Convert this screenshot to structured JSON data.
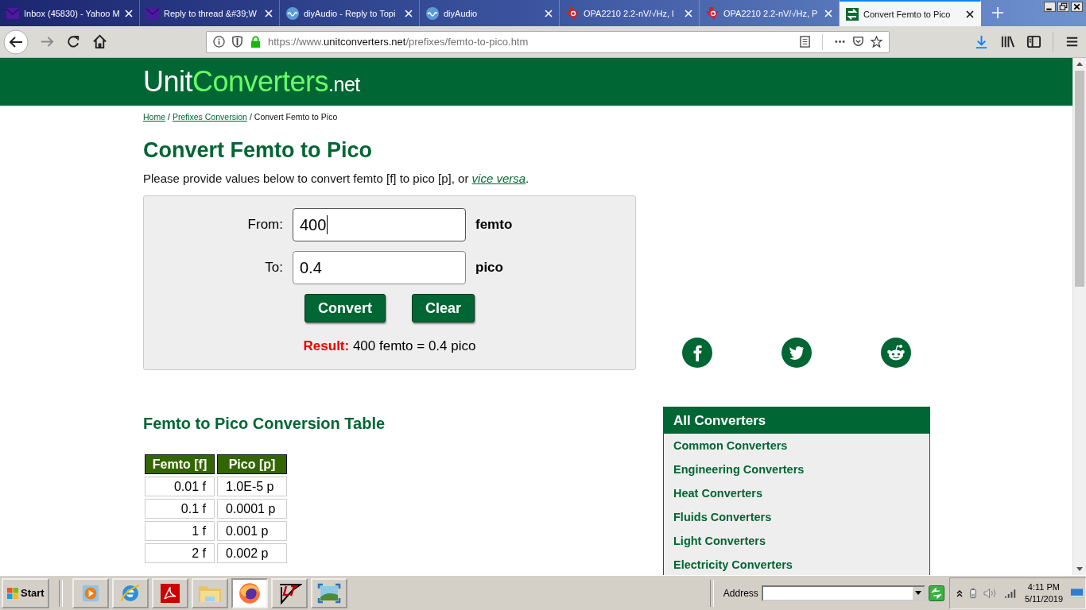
{
  "browser": {
    "tabs": [
      {
        "title": "Inbox (45830) - Yahoo M",
        "kind": "mail",
        "selected": false
      },
      {
        "title": "Reply to thread &#39;W",
        "kind": "mail",
        "selected": false
      },
      {
        "title": "diyAudio - Reply to Topi",
        "kind": "wave",
        "selected": false
      },
      {
        "title": "diyAudio",
        "kind": "wave",
        "selected": false
      },
      {
        "title": "OPA2210 2.2-nV/√Hz, l",
        "kind": "ti",
        "selected": false
      },
      {
        "title": "OPA2210 2.2-nV/√Hz, P",
        "kind": "ti",
        "selected": false
      },
      {
        "title": "Convert Femto to Pico",
        "kind": "uc",
        "selected": true
      }
    ],
    "url": {
      "scheme": "https://www.",
      "host": "unitconverters.net",
      "path": "/prefixes/femto-to-pico.htm"
    }
  },
  "site": {
    "logo": {
      "first": "Unit",
      "second": "Converters",
      "suffix": ".net"
    },
    "breadcrumb": [
      {
        "label": "Home",
        "kind": "link"
      },
      {
        "label": "Prefixes Conversion",
        "kind": "link"
      },
      {
        "label": "Convert Femto to Pico",
        "kind": "current"
      }
    ],
    "separator": "/",
    "heading": "Convert Femto to Pico",
    "intro": {
      "text": "Please provide values below to convert femto [f] to pico [p], or",
      "link": "vice versa",
      "end": "."
    },
    "converter": {
      "fields": [
        {
          "label": "From:",
          "value": "400",
          "unit": "femto",
          "focused": true
        },
        {
          "label": "To:",
          "value": "0.4",
          "unit": "pico",
          "focused": false
        }
      ],
      "buttons": [
        "Convert",
        "Clear"
      ],
      "result": {
        "label": "Result:",
        "text": "400 femto = 0.4 pico"
      }
    },
    "social": [
      {
        "kind": "facebook"
      },
      {
        "kind": "twitter"
      },
      {
        "kind": "reddit"
      }
    ],
    "table": {
      "title": "Femto to Pico Conversion Table",
      "columns": [
        "Femto [f]",
        "Pico [p]"
      ],
      "rows": [
        [
          "0.01 f",
          "1.0E-5 p"
        ],
        [
          "0.1 f",
          "0.0001 p"
        ],
        [
          "1 f",
          "0.001 p"
        ],
        [
          "2 f",
          "0.002 p"
        ]
      ]
    },
    "all_converters": {
      "title": "All Converters",
      "items": [
        "Common Converters",
        "Engineering Converters",
        "Heat Converters",
        "Fluids Converters",
        "Light Converters",
        "Electricity Converters"
      ]
    }
  },
  "taskbar": {
    "start": "Start",
    "apps": [
      {
        "kind": "media",
        "selected": false
      },
      {
        "kind": "ie",
        "selected": false
      },
      {
        "kind": "acrobat",
        "selected": false
      },
      {
        "kind": "folder",
        "selected": false
      },
      {
        "kind": "firefox",
        "selected": true
      },
      {
        "kind": "lt",
        "selected": false
      },
      {
        "kind": "photo",
        "selected": false
      }
    ],
    "address_label": "Address",
    "time": "4:11 PM",
    "date": "5/11/2019"
  }
}
